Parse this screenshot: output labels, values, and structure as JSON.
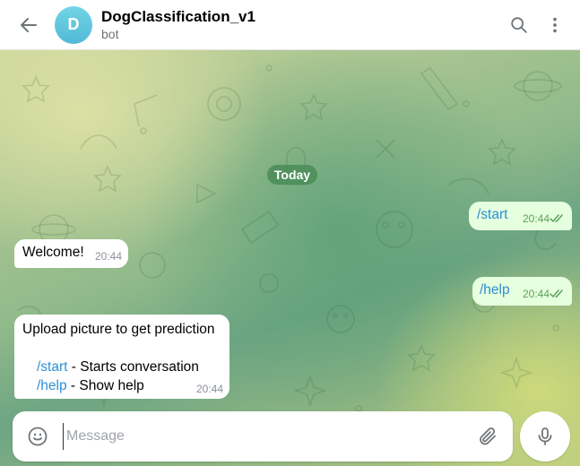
{
  "header": {
    "avatar_letter": "D",
    "title": "DogClassification_v1",
    "subtitle": "bot",
    "icons": {
      "back": "arrow-left-icon",
      "search": "search-icon",
      "menu": "more-vertical-icon"
    }
  },
  "chat": {
    "date_label": "Today",
    "messages": [
      {
        "direction": "out",
        "text": "/start",
        "time": "20:44",
        "status": "read"
      },
      {
        "direction": "in",
        "text": "Welcome!",
        "time": "20:44"
      },
      {
        "direction": "out",
        "text": "/help",
        "time": "20:44",
        "status": "read"
      },
      {
        "direction": "in",
        "line1": "Upload picture to get prediction",
        "cmd1": "/start",
        "desc1": " - Starts conversation",
        "cmd2": "/help",
        "desc2": " - Show help",
        "time": "20:44"
      }
    ]
  },
  "composer": {
    "placeholder": "Message",
    "icons": {
      "emoji": "smile-icon",
      "attach": "paperclip-icon",
      "mic": "microphone-icon"
    }
  },
  "colors": {
    "accent": "#2d8fd5",
    "outgoing_bubble": "#e6ffde",
    "check": "#5ba35b",
    "date_pill": "#4a8c58"
  }
}
